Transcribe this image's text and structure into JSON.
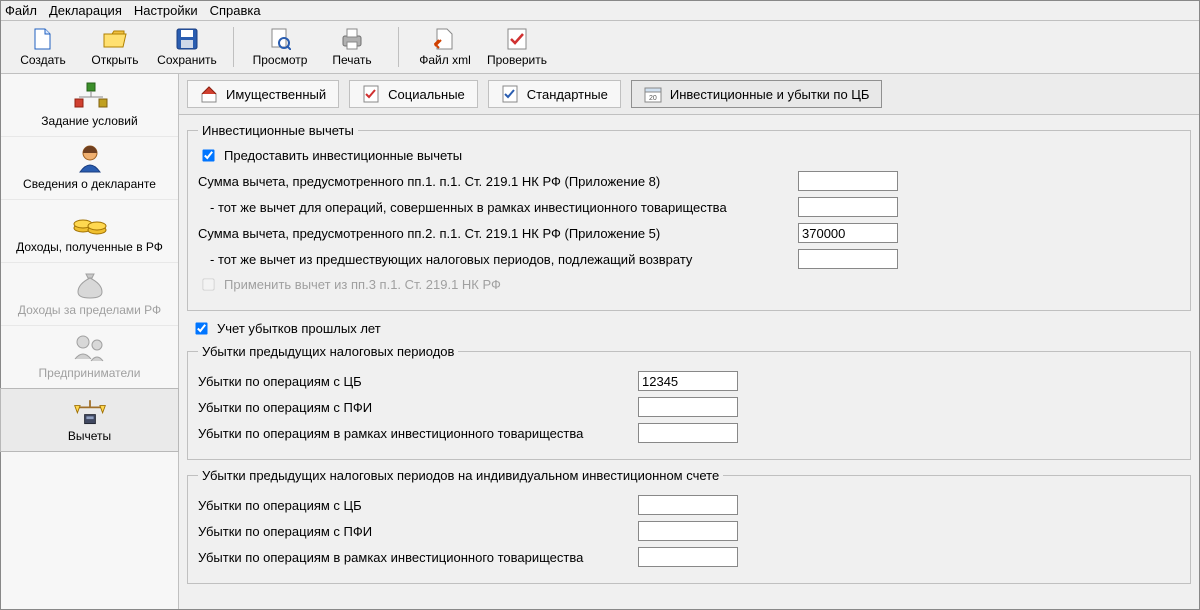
{
  "menu": {
    "file": "Файл",
    "declaration": "Декларация",
    "settings": "Настройки",
    "help": "Справка"
  },
  "toolbar": {
    "create": "Создать",
    "open": "Открыть",
    "save": "Сохранить",
    "preview": "Просмотр",
    "print": "Печать",
    "filexml": "Файл xml",
    "verify": "Проверить"
  },
  "leftnav": {
    "conditions": "Задание условий",
    "declarant": "Сведения о декларанте",
    "income_rf": "Доходы, полученные в РФ",
    "income_abroad": "Доходы за пределами РФ",
    "entrepreneurs": "Предприниматели",
    "deductions": "Вычеты"
  },
  "tabs": {
    "property": "Имущественный",
    "social": "Социальные",
    "standard": "Стандартные",
    "investment": "Инвестиционные и убытки по ЦБ"
  },
  "invest": {
    "legend": "Инвестиционные вычеты",
    "provide": "Предоставить инвестиционные вычеты",
    "line1": "Сумма вычета, предусмотренного пп.1. п.1. Ст. 219.1 НК РФ (Приложение 8)",
    "line1_val": "",
    "line2": "- тот же вычет для операций, совершенных в рамках инвестиционного товарищества",
    "line2_val": "",
    "line3": "Сумма вычета, предусмотренного пп.2. п.1. Ст. 219.1 НК РФ (Приложение 5)",
    "line3_val": "370000",
    "line4": "- тот же вычет из предшествующих налоговых периодов, подлежащий возврату",
    "line4_val": "",
    "apply3": "Применить вычет из пп.3 п.1. Ст. 219.1 НК РФ"
  },
  "losses_prev_chk": "Учет убытков прошлых лет",
  "losses1": {
    "legend": "Убытки предыдущих налоговых периодов",
    "l1": "Убытки по операциям с ЦБ",
    "l1_val": "12345",
    "l2": "Убытки по операциям с ПФИ",
    "l2_val": "",
    "l3": "Убытки по операциям в рамках инвестиционного товарищества",
    "l3_val": ""
  },
  "losses2": {
    "legend": "Убытки предыдущих налоговых периодов на индивидуальном инвестиционном счете",
    "l1": "Убытки по операциям с ЦБ",
    "l1_val": "",
    "l2": "Убытки по операциям с ПФИ",
    "l2_val": "",
    "l3": "Убытки по операциям в рамках инвестиционного товарищества",
    "l3_val": ""
  }
}
